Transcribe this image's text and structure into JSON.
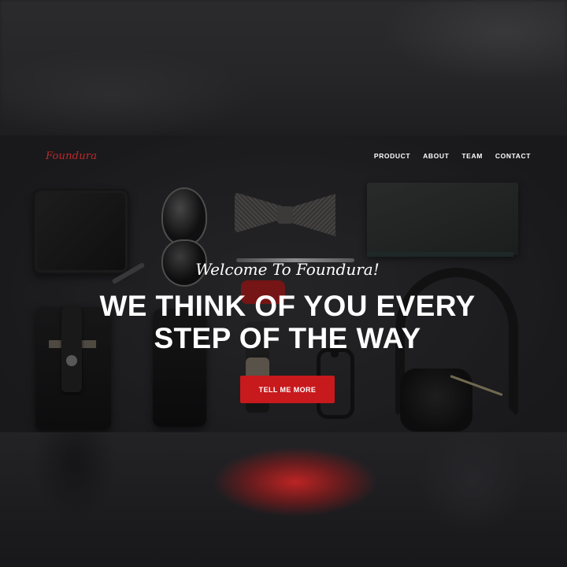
{
  "brand": {
    "name": "Foundura",
    "accent_color": "#c8191c"
  },
  "nav": {
    "items": [
      {
        "label": "PRODUCT"
      },
      {
        "label": "ABOUT"
      },
      {
        "label": "TEAM"
      },
      {
        "label": "CONTACT"
      }
    ]
  },
  "hero": {
    "welcome": "Welcome To Foundura!",
    "headline_line1": "WE THINK OF YOU EVERY",
    "headline_line2": "STEP OF THE WAY",
    "cta_label": "TELL ME MORE"
  }
}
